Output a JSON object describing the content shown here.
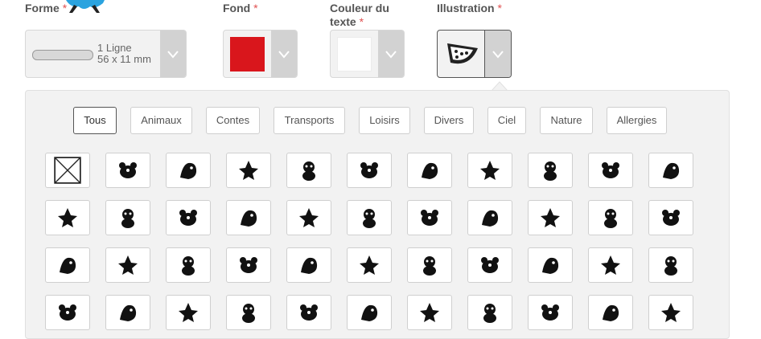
{
  "fields": {
    "forme": {
      "label": "Forme",
      "required_mark": "*",
      "line1": "1 Ligne",
      "line2": "56 x 11 mm"
    },
    "fond": {
      "label": "Fond",
      "required_mark": "*",
      "color": "#d9161c"
    },
    "couleur": {
      "label_line1": "Couleur du",
      "label_line2": "texte",
      "required_mark": "*",
      "color": "#ffffff"
    },
    "illustration": {
      "label": "Illustration",
      "required_mark": "*",
      "selected_icon": "watermelon-icon"
    }
  },
  "categories": [
    {
      "label": "Tous",
      "active": true
    },
    {
      "label": "Animaux",
      "active": false
    },
    {
      "label": "Contes",
      "active": false
    },
    {
      "label": "Transports",
      "active": false
    },
    {
      "label": "Loisirs",
      "active": false
    },
    {
      "label": "Divers",
      "active": false
    },
    {
      "label": "Ciel",
      "active": false
    },
    {
      "label": "Nature",
      "active": false
    },
    {
      "label": "Allergies",
      "active": false
    }
  ],
  "illustrations": [
    [
      "none-icon",
      "cat-icon",
      "dog-icon",
      "hedgehog-icon",
      "fox-icon",
      "rabbit-icon",
      "panda-icon",
      "koala-icon",
      "horse-icon",
      "deer-icon",
      "sheep-icon"
    ],
    [
      "tiger-icon",
      "lion-icon",
      "bear-icon",
      "paw-icon",
      "elephant-icon",
      "parrot-icon",
      "bird-icon",
      "chick-icon",
      "owl-icon",
      "dragonfly-icon",
      "butterfly-icon"
    ],
    [
      "turtle-icon",
      "whale-icon",
      "dolphin-icon",
      "penguin-icon",
      "shark-icon",
      "clownfish-icon",
      "seahorse-icon",
      "dinosaur-icon",
      "brontosaurus-icon",
      "unicorn-icon",
      "ninja-icon"
    ],
    [
      "knight-icon",
      "indian-girl-icon",
      "pirate-icon",
      "princess-icon",
      "mermaid-icon",
      "superheroine-icon",
      "superhero-icon",
      "fairy-icon",
      "pirate-kid-icon",
      "ballerina-icon",
      "robot-icon"
    ]
  ],
  "colors": {
    "accent_required": "#e05050",
    "panel_bg": "#f2f2f2"
  }
}
